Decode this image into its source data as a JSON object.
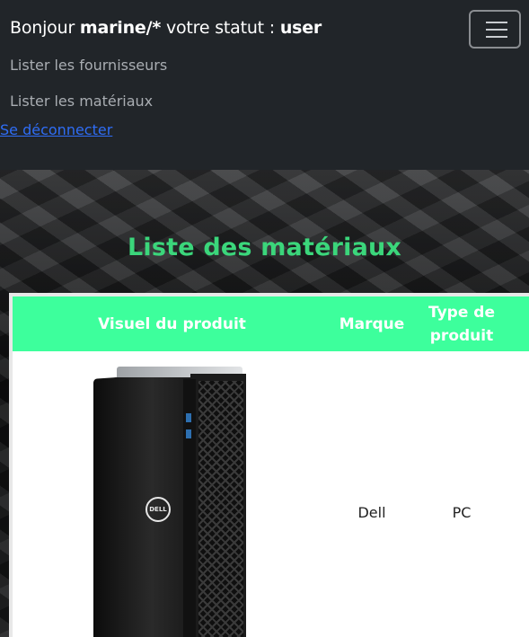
{
  "navbar": {
    "greeting_prefix": "Bonjour",
    "username": "marine/*",
    "status_prefix": "votre statut :",
    "status": "user",
    "links": [
      {
        "label": "Lister les fournisseurs"
      },
      {
        "label": "Lister les matériaux"
      }
    ],
    "logout_label": "Se déconnecter"
  },
  "main": {
    "title": "Liste des matériaux",
    "table": {
      "headers": [
        "Visuel du produit",
        "Marque",
        "Type de produit"
      ],
      "rows": [
        {
          "visual_icon": "tower-pc-image",
          "marque": "Dell",
          "type": "PC",
          "logo_text": "DELL"
        }
      ]
    }
  },
  "colors": {
    "navbar_bg": "#212529",
    "title_green": "#3bd67b",
    "header_green": "#3dff9c",
    "link_blue": "#2f6df5"
  }
}
